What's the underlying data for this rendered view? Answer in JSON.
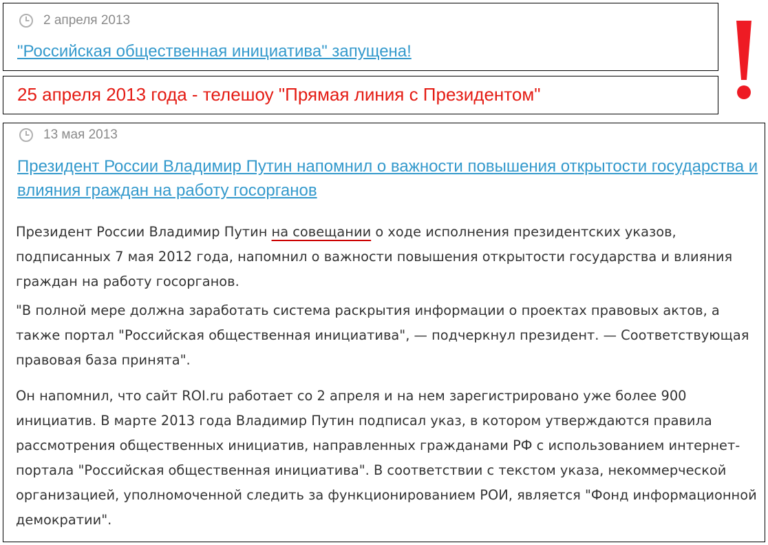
{
  "news1": {
    "date": "2 апреля 2013",
    "title": "\"Российская общественная инициатива\" запущена!"
  },
  "banner": {
    "text": "25 апреля 2013 года - телешоу \"Прямая линия с Президентом\""
  },
  "news2": {
    "date": "13 мая 2013",
    "title": "Президент России Владимир Путин напомнил о важности повышения открытости государства и влияния граждан на работу госорганов",
    "p1_before": "Президент России Владимир Путин ",
    "p1_highlight": "на совещании",
    "p1_after": " о ходе исполнения президентских указов, подписанных 7 мая 2012 года, напомнил о важности повышения открытости государства и влияния граждан на работу госорганов.",
    "p2": "\"В полной мере должна заработать система раскрытия информации о проектах правовых актов, а также портал \"Российская общественная инициатива\", — подчеркнул президент. — Соответствующая правовая база принята\".",
    "p3": "Он напомнил, что сайт ROI.ru работает со 2 апреля и на нем зарегистрировано уже более 900 инициатив. В марте 2013 года Владимир Путин подписал указ, в котором утверждаются правила рассмотрения общественных инициатив, направленных гражданами РФ с использованием интернет-портала \"Российская общественная инициатива\". В соответствии с текстом указа, некоммерческой организацией, уполномоченной следить за функционированием РОИ, является \"Фонд информационной демократии\"."
  },
  "icons": {
    "clock": "clock-icon",
    "exclamation": "exclamation-icon"
  },
  "colors": {
    "link": "#3399cc",
    "banner_red": "#e41b13",
    "date_gray": "#8a8a8a",
    "highlight_underline": "#cc0000"
  }
}
